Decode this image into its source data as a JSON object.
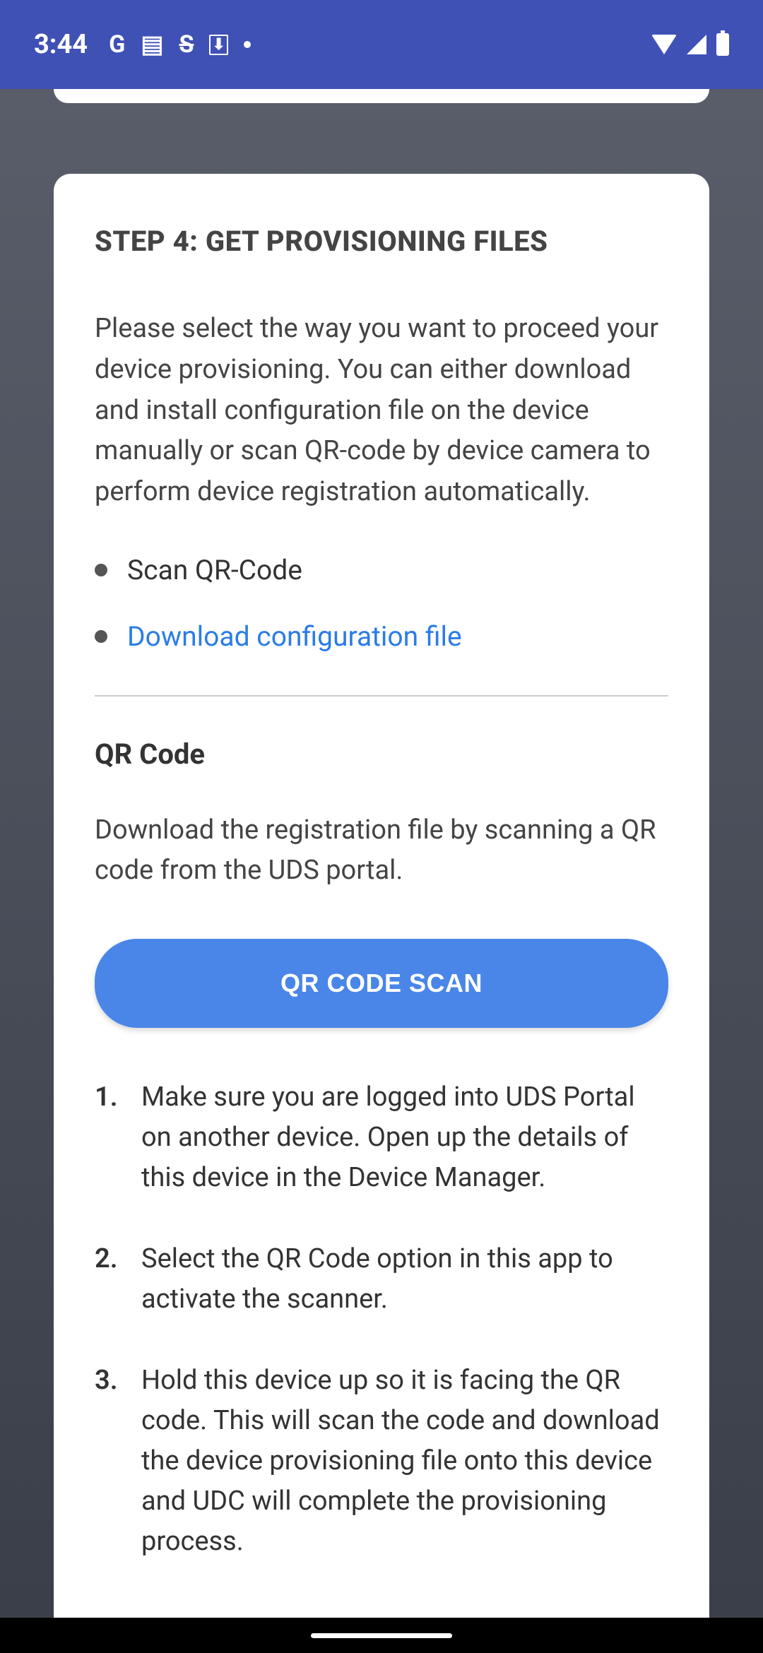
{
  "status": {
    "time": "3:44",
    "glyphs": {
      "g": "G",
      "book": "▤",
      "s": "S",
      "download": "⬇"
    }
  },
  "card": {
    "title": "STEP 4: GET PROVISIONING FILES",
    "description": "Please select the way you want to proceed your device provisioning. You can either download and install configuration file on the device manually or scan QR-code by device camera to perform device registration automatically.",
    "options": {
      "scan": "Scan QR-Code",
      "download": "Download configuration file"
    },
    "qr": {
      "heading": "QR Code",
      "description": "Download the registration file by scanning a QR code from the UDS portal.",
      "button": "QR CODE SCAN",
      "steps": [
        "Make sure you are logged into UDS Portal on another device. Open up the details of this device in the Device Manager.",
        "Select the QR Code option in this app to activate the scanner.",
        "Hold this device up so it is facing the QR code. This will scan the code and download the device provisioning file onto this device and UDC will complete the provisioning process."
      ]
    }
  }
}
